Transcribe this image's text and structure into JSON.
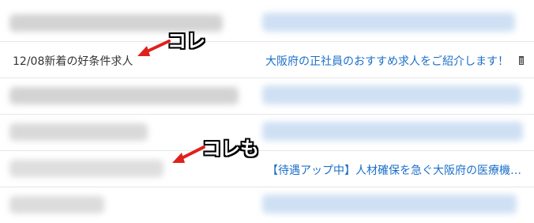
{
  "rows": [
    {
      "sender": "",
      "subject": "",
      "blurred": true
    },
    {
      "sender": "12/08新着の好条件求人",
      "subject": "大阪府の正社員のおすすめ求人をご紹介します！",
      "blurred": false
    },
    {
      "sender": "",
      "subject": "",
      "blurred": true
    },
    {
      "sender": "",
      "subject": "",
      "blurred": true
    },
    {
      "sender": "",
      "subject": "【待遇アップ中】人材確保を急ぐ大阪府の医療機…",
      "blurred": "sender-only"
    },
    {
      "sender": "",
      "subject": "",
      "blurred": true
    }
  ],
  "annotations": {
    "first": "コレ",
    "second": "コレも"
  },
  "colors": {
    "subject_link": "#1a6fc9",
    "sender_text": "#333333",
    "arrow": "#e0201b",
    "row_divider": "#e6e6e6"
  },
  "icons": {
    "trailing": "trash-icon",
    "arrow": "red-arrow-icon"
  }
}
